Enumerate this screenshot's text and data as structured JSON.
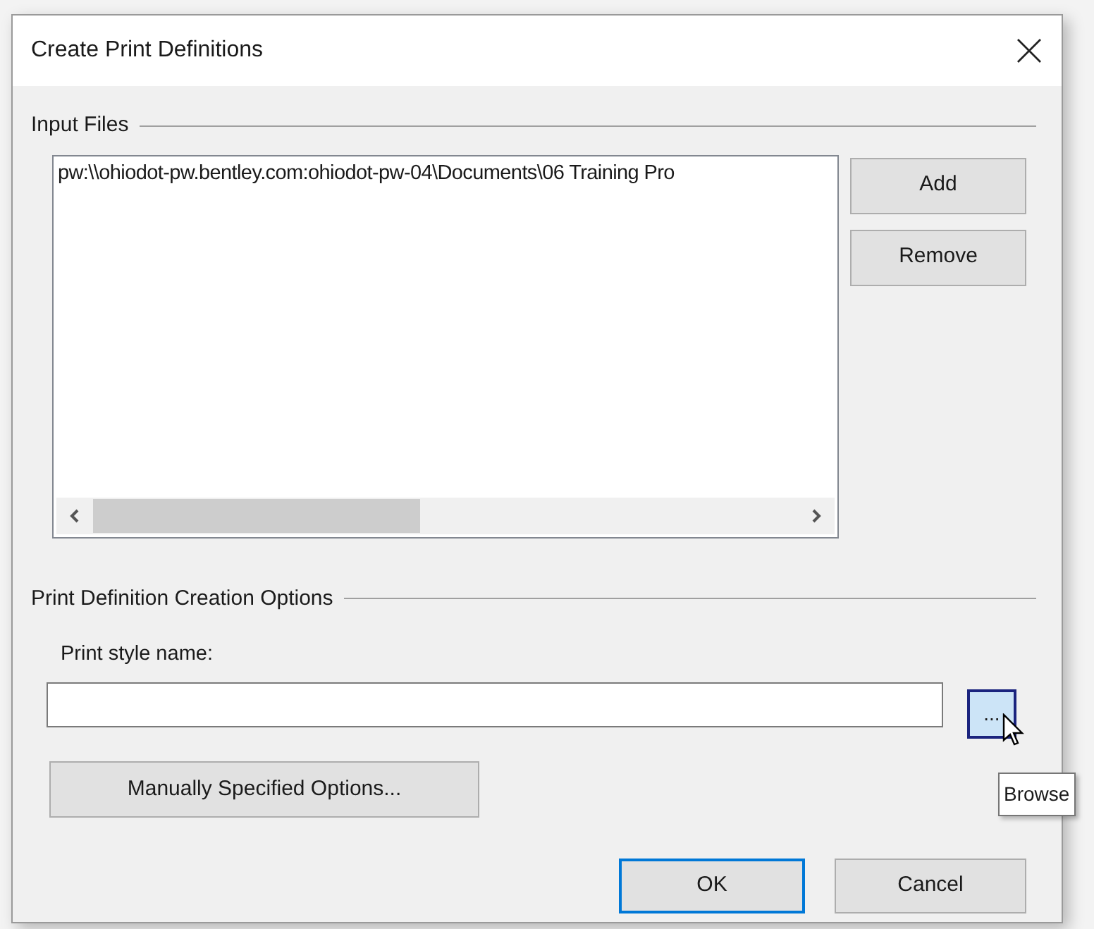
{
  "window": {
    "title": "Create Print Definitions"
  },
  "input_files": {
    "label": "Input Files",
    "files": [
      "pw:\\\\ohiodot-pw.bentley.com:ohiodot-pw-04\\Documents\\06 Training Pro"
    ],
    "buttons": [
      {
        "label": "Add"
      },
      {
        "label": "Remove"
      }
    ]
  },
  "options": {
    "label": "Print Definition Creation Options",
    "style_label": "Print style name:",
    "browse": {
      "label": "...",
      "hovered": true,
      "tooltip": "Browse"
    },
    "manual_button": "Manually Specified Options..."
  },
  "footer_buttons": [
    {
      "label": "OK",
      "focused": true
    },
    {
      "label": "Cancel",
      "focused": false
    }
  ]
}
